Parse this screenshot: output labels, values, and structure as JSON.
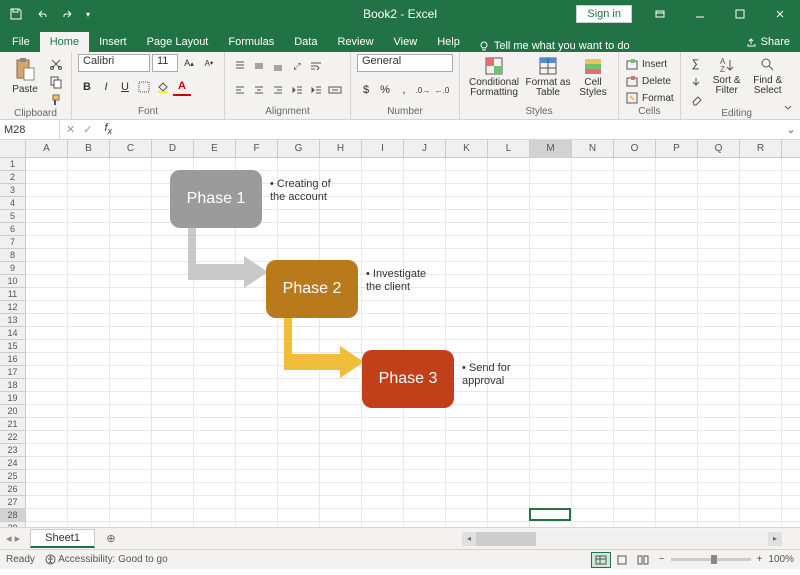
{
  "title": "Book2 - Excel",
  "signin": "Sign in",
  "tabs": [
    "File",
    "Home",
    "Insert",
    "Page Layout",
    "Formulas",
    "Data",
    "Review",
    "View",
    "Help"
  ],
  "active_tab": "Home",
  "tell_me": "Tell me what you want to do",
  "share": "Share",
  "ribbon": {
    "clipboard": {
      "label": "Clipboard",
      "paste": "Paste"
    },
    "font": {
      "label": "Font",
      "name": "Calibri",
      "size": "11",
      "bold": "B",
      "italic": "I",
      "underline": "U"
    },
    "alignment": {
      "label": "Alignment"
    },
    "number": {
      "label": "Number",
      "format": "General"
    },
    "styles": {
      "label": "Styles",
      "cond": "Conditional Formatting",
      "table": "Format as Table",
      "cell": "Cell Styles"
    },
    "cells": {
      "label": "Cells",
      "insert": "Insert",
      "delete": "Delete",
      "format": "Format"
    },
    "editing": {
      "label": "Editing",
      "sort": "Sort & Filter",
      "find": "Find & Select"
    }
  },
  "namebox": "M28",
  "columns": [
    "A",
    "B",
    "C",
    "D",
    "E",
    "F",
    "G",
    "H",
    "I",
    "J",
    "K",
    "L",
    "M",
    "N",
    "O",
    "P",
    "Q",
    "R"
  ],
  "rows": 29,
  "selected": {
    "col": "M",
    "row": 28
  },
  "smartart": {
    "phase1": {
      "title": "Phase 1",
      "bullet": "Creating of the account",
      "color": "#9b9b9b"
    },
    "phase2": {
      "title": "Phase 2",
      "bullet": "Investigate the client",
      "color": "#b97a1c"
    },
    "phase3": {
      "title": "Phase 3",
      "bullet": "Send for approval",
      "color": "#c1401a"
    }
  },
  "sheet": "Sheet1",
  "status": {
    "ready": "Ready",
    "accessibility": "Accessibility: Good to go",
    "zoom": "100%"
  }
}
